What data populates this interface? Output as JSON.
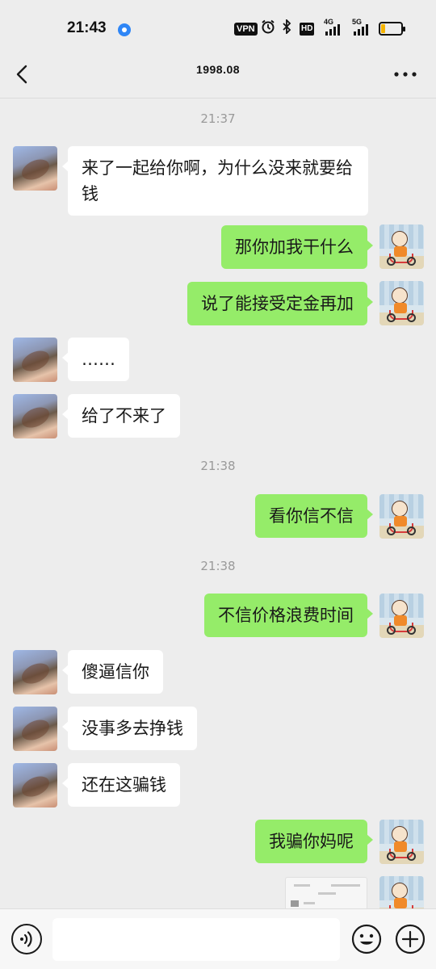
{
  "status_bar": {
    "time": "21:43",
    "vpn": "VPN",
    "alarm_icon": "alarm-icon",
    "bluetooth_icon": "bluetooth-icon",
    "hd": "HD",
    "net1": "4G",
    "net2": "5G",
    "battery_level": 0.2,
    "battery_color": "#f5b400"
  },
  "header": {
    "title": "1998.08",
    "back_icon": "back-icon",
    "more_icon": "more-icon"
  },
  "chat": {
    "times": [
      "21:37",
      "21:38",
      "21:38"
    ],
    "messages": [
      {
        "from": "other",
        "text": "来了一起给你啊，为什么没来就要给钱"
      },
      {
        "from": "me",
        "text": "那你加我干什么"
      },
      {
        "from": "me",
        "text": "说了能接受定金再加"
      },
      {
        "from": "other",
        "text": "……"
      },
      {
        "from": "other",
        "text": "给了不来了"
      },
      {
        "from": "me",
        "text": "看你信不信"
      },
      {
        "from": "me",
        "text": "不信价格浪费时间"
      },
      {
        "from": "other",
        "text": "傻逼信你"
      },
      {
        "from": "other",
        "text": "没事多去挣钱"
      },
      {
        "from": "other",
        "text": "还在这骗钱"
      },
      {
        "from": "me",
        "text": "我骗你妈呢"
      }
    ],
    "bubble_colors": {
      "me": "#95ec69",
      "other": "#ffffff"
    }
  },
  "input_bar": {
    "voice_icon": "voice-icon",
    "emoji_icon": "emoji-icon",
    "plus_icon": "plus-icon",
    "value": ""
  }
}
